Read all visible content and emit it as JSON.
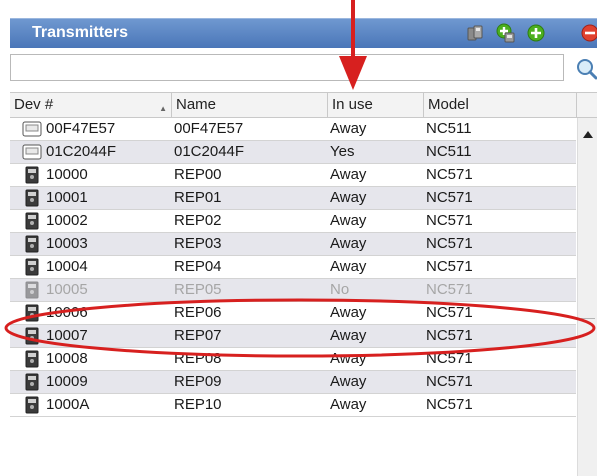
{
  "panel": {
    "title": "Transmitters",
    "toolbar_icons": [
      "transmitter-group-icon",
      "add-transmitter-icon",
      "add-icon",
      "remove-icon"
    ]
  },
  "search": {
    "value": "",
    "placeholder": ""
  },
  "columns": [
    "Dev #",
    "Name",
    "In use",
    "Model"
  ],
  "sort": {
    "column": "Dev #",
    "direction": "ascending"
  },
  "rows": [
    {
      "dev": "00F47E57",
      "name": "00F47E57",
      "in_use": "Away",
      "model": "NC511",
      "icon": "pager-icon"
    },
    {
      "dev": "01C2044F",
      "name": "01C2044F",
      "in_use": "Yes",
      "model": "NC511",
      "icon": "pager-icon"
    },
    {
      "dev": "10000",
      "name": "REP00",
      "in_use": "Away",
      "model": "NC571",
      "icon": "repeater-icon"
    },
    {
      "dev": "10001",
      "name": "REP01",
      "in_use": "Away",
      "model": "NC571",
      "icon": "repeater-icon"
    },
    {
      "dev": "10002",
      "name": "REP02",
      "in_use": "Away",
      "model": "NC571",
      "icon": "repeater-icon"
    },
    {
      "dev": "10003",
      "name": "REP03",
      "in_use": "Away",
      "model": "NC571",
      "icon": "repeater-icon"
    },
    {
      "dev": "10004",
      "name": "REP04",
      "in_use": "Away",
      "model": "NC571",
      "icon": "repeater-icon"
    },
    {
      "dev": "10005",
      "name": "REP05",
      "in_use": "No",
      "model": "NC571",
      "icon": "repeater-icon",
      "dimmed": true
    },
    {
      "dev": "10006",
      "name": "REP06",
      "in_use": "Away",
      "model": "NC571",
      "icon": "repeater-icon"
    },
    {
      "dev": "10007",
      "name": "REP07",
      "in_use": "Away",
      "model": "NC571",
      "icon": "repeater-icon"
    },
    {
      "dev": "10008",
      "name": "REP08",
      "in_use": "Away",
      "model": "NC571",
      "icon": "repeater-icon"
    },
    {
      "dev": "10009",
      "name": "REP09",
      "in_use": "Away",
      "model": "NC571",
      "icon": "repeater-icon"
    },
    {
      "dev": "1000A",
      "name": "REP10",
      "in_use": "Away",
      "model": "NC571",
      "icon": "repeater-icon"
    }
  ],
  "annotations": {
    "color": "#d7201f"
  },
  "colors": {
    "titlebar": "#5b86c4",
    "row_alt": "#e6e6ec",
    "dim_text": "#a6a6a6",
    "add_green": "#4caf1e",
    "remove_red": "#e0412f"
  }
}
